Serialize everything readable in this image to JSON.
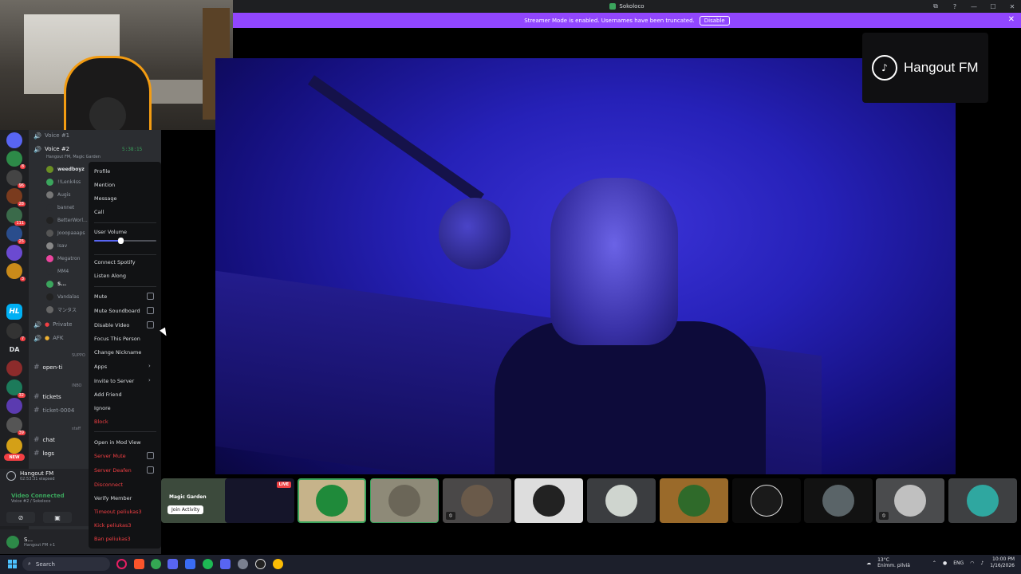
{
  "window": {
    "title": "Sokoloco",
    "controls": [
      "⧉",
      "?",
      "—",
      "☐",
      "✕"
    ]
  },
  "banner": {
    "text": "Streamer Mode is enabled. Usernames have been truncated.",
    "disable_label": "Disable",
    "close": "✕"
  },
  "rail": {
    "badges": [
      "8",
      "96",
      "28",
      "111",
      "25",
      "3",
      "7",
      "32",
      "39"
    ],
    "da_label": "DA",
    "hl_label": "HL",
    "new_label": "NEW"
  },
  "channels": {
    "voice1": "Voice #1",
    "voice2": "Voice #2",
    "voice2_timer": "5:38:15",
    "voice2_sub": "Hangout FM, Magic Garden",
    "members": [
      "weedboyz",
      "!!Lenk4ss",
      "Augis",
      "bannet",
      "BetterWorl...",
      "Jooopaaaps",
      "Isav",
      "Megatron",
      "MM4",
      "S...",
      "Vandalas",
      "マンタス"
    ],
    "private": "Private",
    "afk": "AFK",
    "support_cat": "SUPPO",
    "open_ti": "open-ti",
    "inbox_cat": "INBO",
    "tickets": "tickets",
    "ticket4": "ticket-0004",
    "staff_cat": "staff",
    "chat": "chat",
    "logs": "logs"
  },
  "now_playing": {
    "title": "Hangout FM",
    "elapsed": "02:53:31 elapsed"
  },
  "voice_status": {
    "title": "Video Connected",
    "sub": "Voice #2 / Sokoloco"
  },
  "user": {
    "name": "S...",
    "status": "Hangout FM +1"
  },
  "context_menu": {
    "profile": "Profile",
    "mention": "Mention",
    "message": "Message",
    "call": "Call",
    "user_volume": "User Volume",
    "volume_value": 0.42,
    "connect_spotify": "Connect Spotify",
    "listen_along": "Listen Along",
    "mute": "Mute",
    "mute_soundboard": "Mute Soundboard",
    "disable_video": "Disable Video",
    "focus": "Focus This Person",
    "change_nickname": "Change Nickname",
    "apps": "Apps",
    "invite": "Invite to Server",
    "add_friend": "Add Friend",
    "ignore": "Ignore",
    "block": "Block",
    "open_mod_view": "Open in Mod View",
    "server_mute": "Server Mute",
    "server_deafen": "Server Deafen",
    "disconnect": "Disconnect",
    "verify_member": "Verify Member",
    "timeout": "Timeout peliukas3",
    "kick": "Kick peliukas3",
    "ban": "Ban peliukas3"
  },
  "stage": {
    "brand": "Hangout FM"
  },
  "strip": {
    "magic_garden": "Magic Garden",
    "join_activity": "Join Activity",
    "live": "LIVE"
  },
  "taskbar": {
    "search": "Search",
    "weather_temp": "13°C",
    "weather_desc": "Enimm. pilviä",
    "lang": "ENG",
    "time": "10:00 PM",
    "date": "1/16/2026"
  },
  "colors": {
    "accent": "#5865f2",
    "banner": "#9146ff",
    "danger": "#f23f43",
    "connected": "#3ba55d"
  }
}
